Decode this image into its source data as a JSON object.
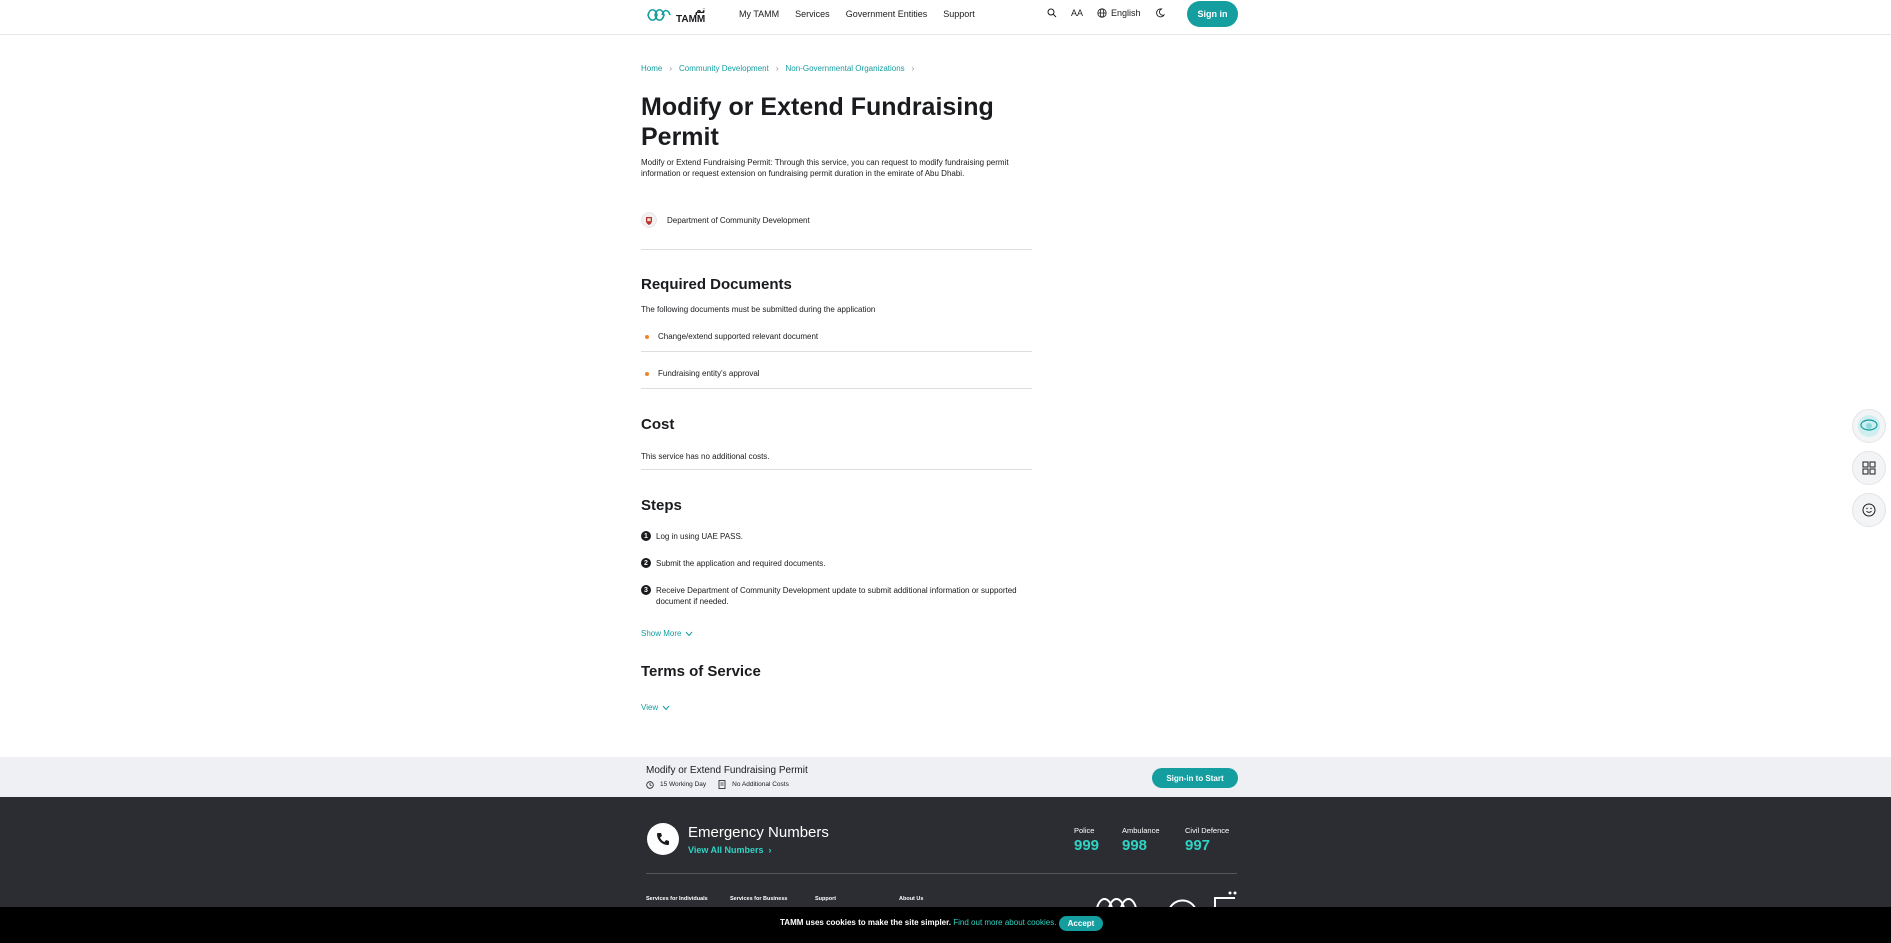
{
  "header": {
    "logo_text": "TAMM",
    "logo_text_ar": "تم",
    "nav": [
      "My TAMM",
      "Services",
      "Government Entities",
      "Support"
    ],
    "font_size_label": "AA",
    "language": "English",
    "sign_in": "Sign in"
  },
  "breadcrumb": [
    "Home",
    "Community Development",
    "Non-Governmental Organizations"
  ],
  "page": {
    "title": "Modify or Extend Fundraising Permit",
    "description": "Modify or Extend Fundraising Permit: Through this service, you can request to modify fundraising permit information or request extension on fundraising permit duration in the emirate of Abu Dhabi.",
    "department": "Department of Community Development"
  },
  "required_documents": {
    "heading": "Required Documents",
    "intro": "The following documents must be submitted during the application",
    "items": [
      "Change/extend supported relevant document",
      "Fundraising entity's approval"
    ]
  },
  "cost": {
    "heading": "Cost",
    "text": "This service has no additional costs."
  },
  "steps": {
    "heading": "Steps",
    "items": [
      {
        "num": "1",
        "text": "Log in using UAE PASS."
      },
      {
        "num": "2",
        "text": "Submit the application and required documents."
      },
      {
        "num": "3",
        "text": "Receive Department of Community Development update to submit additional information or supported document if needed."
      }
    ],
    "show_more": "Show More"
  },
  "terms": {
    "heading": "Terms of Service",
    "view": "View"
  },
  "service_bar": {
    "title": "Modify or Extend Fundraising Permit",
    "duration": "15 Working Day",
    "cost": "No Additional Costs",
    "button": "Sign-in to Start"
  },
  "footer": {
    "emergency_title": "Emergency Numbers",
    "view_all": "View All Numbers",
    "numbers": [
      {
        "label": "Police",
        "value": "999"
      },
      {
        "label": "Ambulance",
        "value": "998"
      },
      {
        "label": "Civil Defence",
        "value": "997"
      }
    ],
    "columns": [
      "Services for Individuals",
      "Services for Business",
      "Support",
      "About Us"
    ]
  },
  "cookie": {
    "text": "TAMM uses cookies to make the site simpler.",
    "link": "Find out more about cookies.",
    "accept": "Accept"
  },
  "colors": {
    "accent": "#149ea0",
    "bullet": "#f0842c",
    "footer_bg": "#2c2d33",
    "footer_accent": "#2fd3c3"
  }
}
